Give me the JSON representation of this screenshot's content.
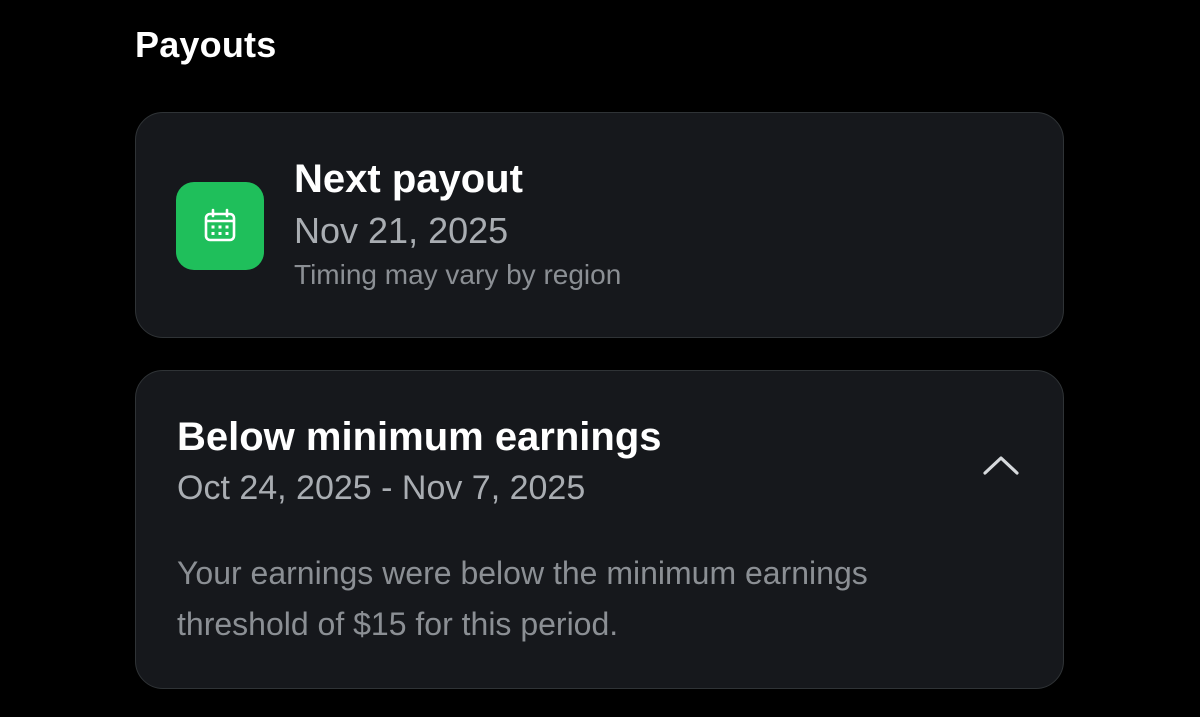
{
  "page": {
    "title": "Payouts"
  },
  "next_payout": {
    "icon": "calendar-icon",
    "title": "Next payout",
    "date": "Nov 21, 2025",
    "note": "Timing may vary by region"
  },
  "below_minimum": {
    "title": "Below minimum earnings",
    "date_range": "Oct 24, 2025 - Nov 7, 2025",
    "body": "Your earnings were below the minimum earnings threshold of $15 for this period.",
    "toggle_icon": "chevron-up-icon"
  },
  "colors": {
    "background": "#000000",
    "card": "#16181c",
    "accent_green": "#1fbf5b",
    "primary_text": "#ffffff",
    "secondary_text": "#a9adb2"
  }
}
